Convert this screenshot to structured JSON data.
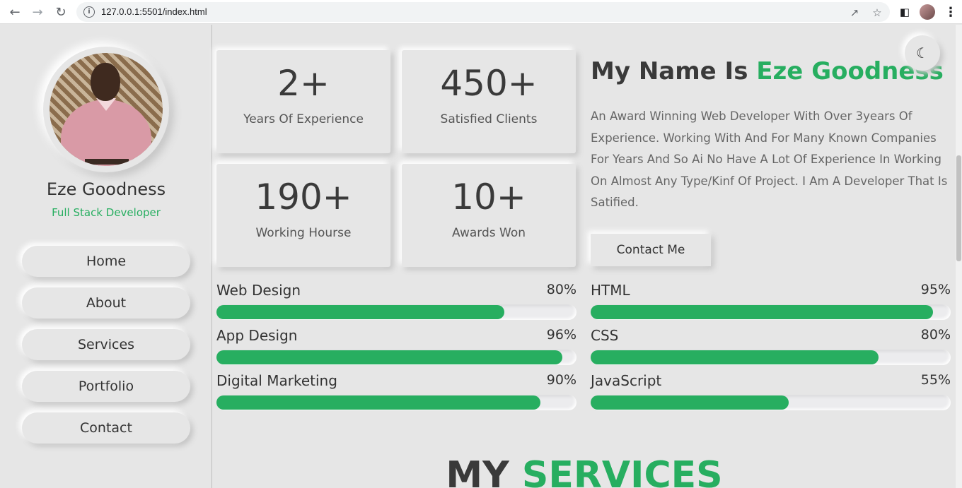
{
  "browser": {
    "url": "127.0.0.1:5501/index.html",
    "icons": [
      "back-icon",
      "forward-icon",
      "reload-icon",
      "info-icon",
      "share-icon",
      "star-icon",
      "side-panel-icon",
      "profile-avatar",
      "menu-icon"
    ]
  },
  "sidebar": {
    "name": "Eze Goodness",
    "role": "Full Stack Developer",
    "nav": [
      {
        "label": "Home"
      },
      {
        "label": "About"
      },
      {
        "label": "Services"
      },
      {
        "label": "Portfolio"
      },
      {
        "label": "Contact"
      }
    ]
  },
  "stats": [
    {
      "value": "2+",
      "label": "Years Of Experience"
    },
    {
      "value": "450+",
      "label": "Satisfied Clients"
    },
    {
      "value": "190+",
      "label": "Working Hourse"
    },
    {
      "value": "10+",
      "label": "Awards Won"
    }
  ],
  "hero": {
    "title_prefix": "My Name Is",
    "title_name": "Eze Goodness",
    "description": "An Award Winning Web Developer With Over 3years Of Experience. Working With And For Many Known Companies For Years And So Ai No Have A Lot Of Experience In Working On Almost Any Type/Kinf Of Project. I Am A Developer That Is Satified.",
    "contact_label": "Contact Me"
  },
  "skills_left": [
    {
      "name": "Web Design",
      "percent_label": "80%",
      "percent": 80
    },
    {
      "name": "App Design",
      "percent_label": "96%",
      "percent": 96
    },
    {
      "name": "Digital Marketing",
      "percent_label": "90%",
      "percent": 90
    }
  ],
  "skills_right": [
    {
      "name": "HTML",
      "percent_label": "95%",
      "percent": 95
    },
    {
      "name": "CSS",
      "percent_label": "80%",
      "percent": 80
    },
    {
      "name": "JavaScript",
      "percent_label": "55%",
      "percent": 55
    }
  ],
  "services_title": {
    "prefix": "MY",
    "highlight": "SERVICES"
  },
  "colors": {
    "accent": "#27ae60",
    "background": "#e6e6e6"
  },
  "theme_toggle_icon": "moon-icon"
}
